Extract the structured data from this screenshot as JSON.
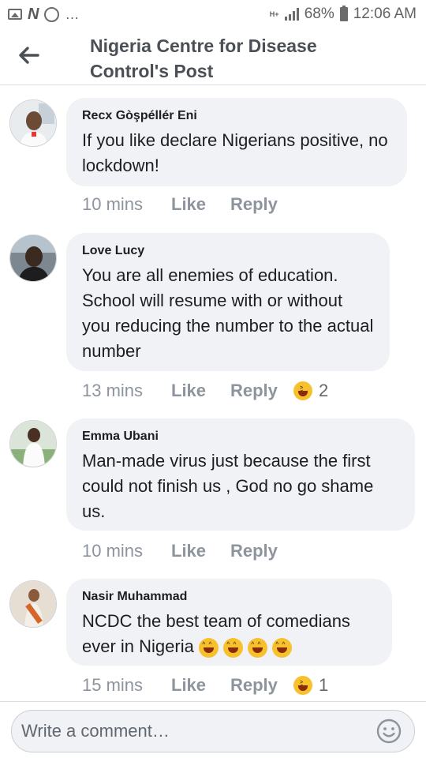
{
  "status_bar": {
    "network_label": "H+",
    "battery": "68%",
    "time": "12:06 AM"
  },
  "header": {
    "title_line1": "Nigeria Centre for Disease",
    "title_line2": "Control's Post"
  },
  "actions": {
    "like": "Like",
    "reply": "Reply"
  },
  "comments": [
    {
      "name": "Recx Gòşpéllér Eni",
      "text": "If you like declare Nigerians positive, no lockdown!",
      "time": "10 mins",
      "reaction_count": ""
    },
    {
      "name": "Love Lucy",
      "text": "You are all enemies of education. School will resume with or without you reducing the number to the actual number",
      "time": "13 mins",
      "reaction_count": "2"
    },
    {
      "name": "Emma Ubani",
      "text": "Man-made virus just because the first could not finish us , God no go shame us.",
      "time": "10 mins",
      "reaction_count": ""
    },
    {
      "name": "Nasir Muhammad",
      "text": "NCDC the best team of comedians ever in Nigeria",
      "time": "15 mins",
      "reaction_count": "1"
    }
  ],
  "composer": {
    "placeholder": "Write a comment…"
  },
  "icons": {
    "back": "back-arrow-icon",
    "reaction": "laughing-emoji-icon",
    "emoji_picker": "smiley-icon"
  },
  "colors": {
    "bubble": "#f0f2f5",
    "text": "#1c1e21",
    "meta": "#8d949e",
    "emoji": "#f7c12d"
  }
}
